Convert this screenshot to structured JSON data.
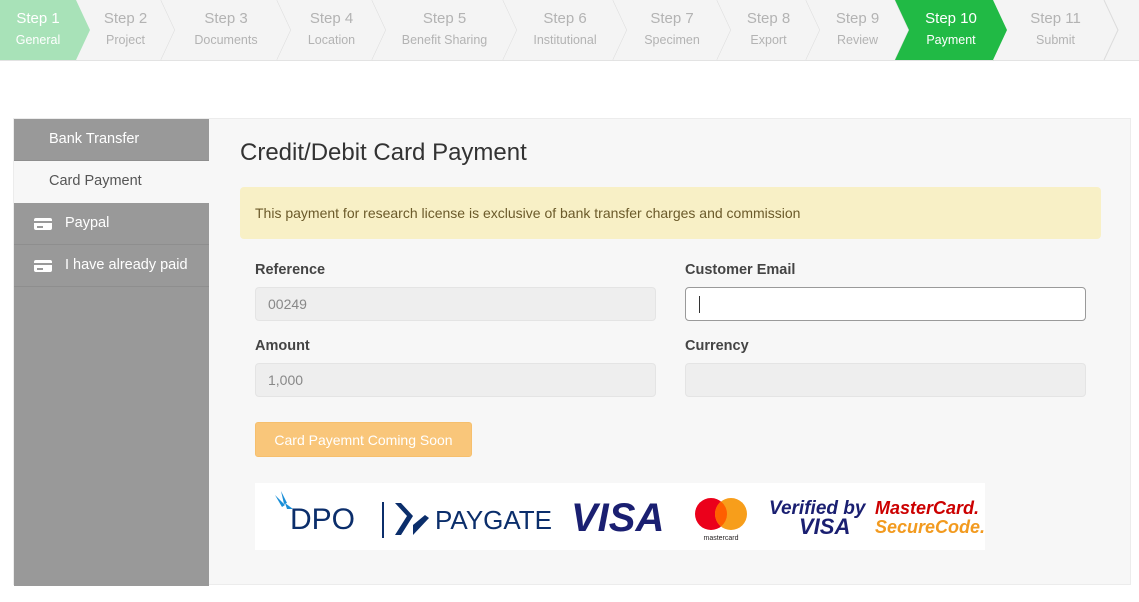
{
  "wizard": {
    "steps": [
      {
        "num": "Step 1",
        "label": "General",
        "state": "done"
      },
      {
        "num": "Step 2",
        "label": "Project",
        "state": "pending"
      },
      {
        "num": "Step 3",
        "label": "Documents",
        "state": "pending"
      },
      {
        "num": "Step 4",
        "label": "Location",
        "state": "pending"
      },
      {
        "num": "Step 5",
        "label": "Benefit Sharing",
        "state": "pending"
      },
      {
        "num": "Step 6",
        "label": "Institutional",
        "state": "pending"
      },
      {
        "num": "Step 7",
        "label": "Specimen",
        "state": "pending"
      },
      {
        "num": "Step 8",
        "label": "Export",
        "state": "pending"
      },
      {
        "num": "Step 9",
        "label": "Review",
        "state": "pending"
      },
      {
        "num": "Step 10",
        "label": "Payment",
        "state": "active"
      },
      {
        "num": "Step 11",
        "label": "Submit",
        "state": "pending"
      }
    ],
    "colors": {
      "done": "#a8e2b8",
      "active": "#21ba45",
      "pending": "#f4f4f4"
    }
  },
  "sidebar": {
    "items": [
      {
        "label": "Bank Transfer",
        "icon": null,
        "active": false
      },
      {
        "label": "Card Payment",
        "icon": null,
        "active": true
      },
      {
        "label": "Paypal",
        "icon": "credit-card-icon",
        "active": false
      },
      {
        "label": "I have already paid",
        "icon": "credit-card-icon",
        "active": false
      }
    ]
  },
  "payment": {
    "title": "Credit/Debit Card Payment",
    "notice": "This payment for research license is exclusive of bank transfer charges and commission",
    "reference": {
      "label": "Reference",
      "value": "00249"
    },
    "customer_email": {
      "label": "Customer Email",
      "value": ""
    },
    "amount": {
      "label": "Amount",
      "value": "1,000"
    },
    "currency": {
      "label": "Currency",
      "value": ""
    },
    "button_label": "Card Payemnt Coming Soon",
    "logos": {
      "dpo": "DPO",
      "paygate": "PAYGATE",
      "visa": "VISA",
      "mastercard": "mastercard",
      "verified_by": "Verified by",
      "verified_visa": "VISA",
      "mc_securecode_1": "MasterCard.",
      "mc_securecode_2": "SecureCode."
    }
  }
}
